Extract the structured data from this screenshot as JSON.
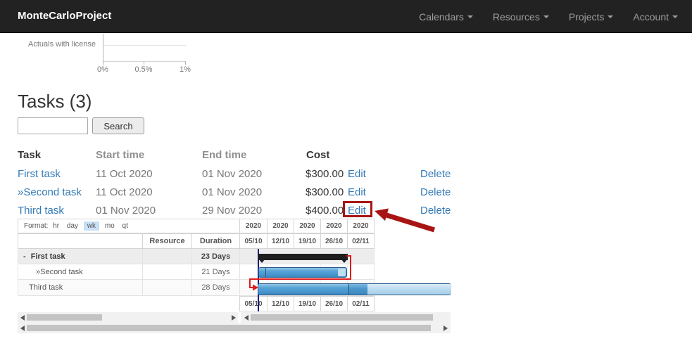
{
  "navbar": {
    "brand": "MonteCarloProject",
    "items": [
      {
        "label": "Calendars"
      },
      {
        "label": "Resources"
      },
      {
        "label": "Projects"
      },
      {
        "label": "Account"
      }
    ]
  },
  "mini_chart": {
    "type": "bar",
    "category_label": "Actuals with license",
    "x_ticks": [
      "0%",
      "0.5%",
      "1%"
    ]
  },
  "tasks_section": {
    "title": "Tasks (3)",
    "search": {
      "value": "",
      "placeholder": "",
      "button_label": "Search"
    }
  },
  "tasks_table": {
    "headers": {
      "task": "Task",
      "start": "Start time",
      "end": "End time",
      "cost": "Cost"
    },
    "rows": [
      {
        "task": "First task",
        "start": "11 Oct 2020",
        "end": "01 Nov 2020",
        "cost": "$300.00",
        "edit": "Edit",
        "delete": "Delete"
      },
      {
        "task": "»Second task",
        "start": "11 Oct 2020",
        "end": "01 Nov 2020",
        "cost": "$300.00",
        "edit": "Edit",
        "delete": "Delete"
      },
      {
        "task": "Third task",
        "start": "01 Nov 2020",
        "end": "29 Nov 2020",
        "cost": "$400.00",
        "edit": "Edit",
        "delete": "Delete"
      }
    ]
  },
  "gantt": {
    "format": {
      "label": "Format:",
      "options": [
        "hr",
        "day",
        "wk",
        "mo",
        "qt"
      ],
      "selected": "wk"
    },
    "columns": {
      "resource": "Resource",
      "duration": "Duration"
    },
    "years": [
      "2020",
      "2020",
      "2020",
      "2020",
      "2020"
    ],
    "weeks": [
      "05/10",
      "12/10",
      "19/10",
      "26/10",
      "02/11"
    ],
    "rows": [
      {
        "collapse": "-",
        "name": "First task",
        "duration": "23 Days"
      },
      {
        "collapse": "",
        "name": "»Second task",
        "duration": "21 Days"
      },
      {
        "collapse": "",
        "name": "Third task",
        "duration": "28 Days"
      }
    ]
  },
  "colors": {
    "navbar_bg": "#222222",
    "navbar_link": "#9d9d9d",
    "link_blue": "#337ab7",
    "annotation_red": "#a81414",
    "dependency_red": "#e01b1b",
    "bar_blue": "#4e9dd2",
    "bar_light_blue": "#bedff2",
    "summary_bar_black": "#1e1e1e",
    "timeline_marker_blue": "#1c1d7d",
    "wk_highlight": "#c9e0f6"
  }
}
